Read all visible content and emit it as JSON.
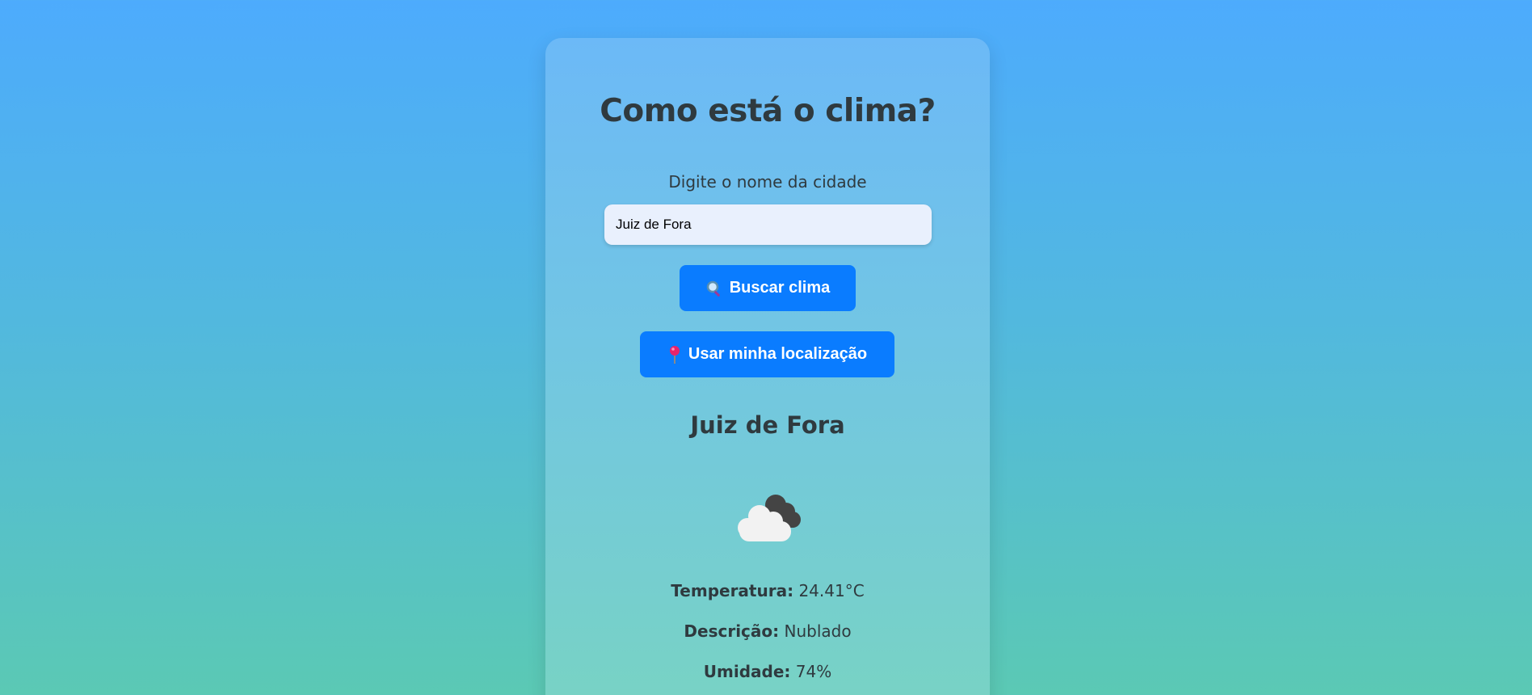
{
  "header": {
    "title": "Como está o clima?"
  },
  "search": {
    "label": "Digite o nome da cidade",
    "value": "Juiz de Fora",
    "placeholder": ""
  },
  "buttons": {
    "search_label": "Buscar clima",
    "search_icon": "magnifier-icon",
    "location_label": "Usar minha localização",
    "location_icon": "pin-icon"
  },
  "result": {
    "city": "Juiz de Fora",
    "weather_icon": "clouds-icon",
    "temperature_label": "Temperatura:",
    "temperature_value": "24.41°C",
    "description_label": "Descrição:",
    "description_value": "Nublado",
    "humidity_label": "Umidade:",
    "humidity_value": "74%"
  },
  "colors": {
    "accent": "#0a7cff",
    "text": "#2f3a3f",
    "input_bg": "#e9f0fd"
  }
}
